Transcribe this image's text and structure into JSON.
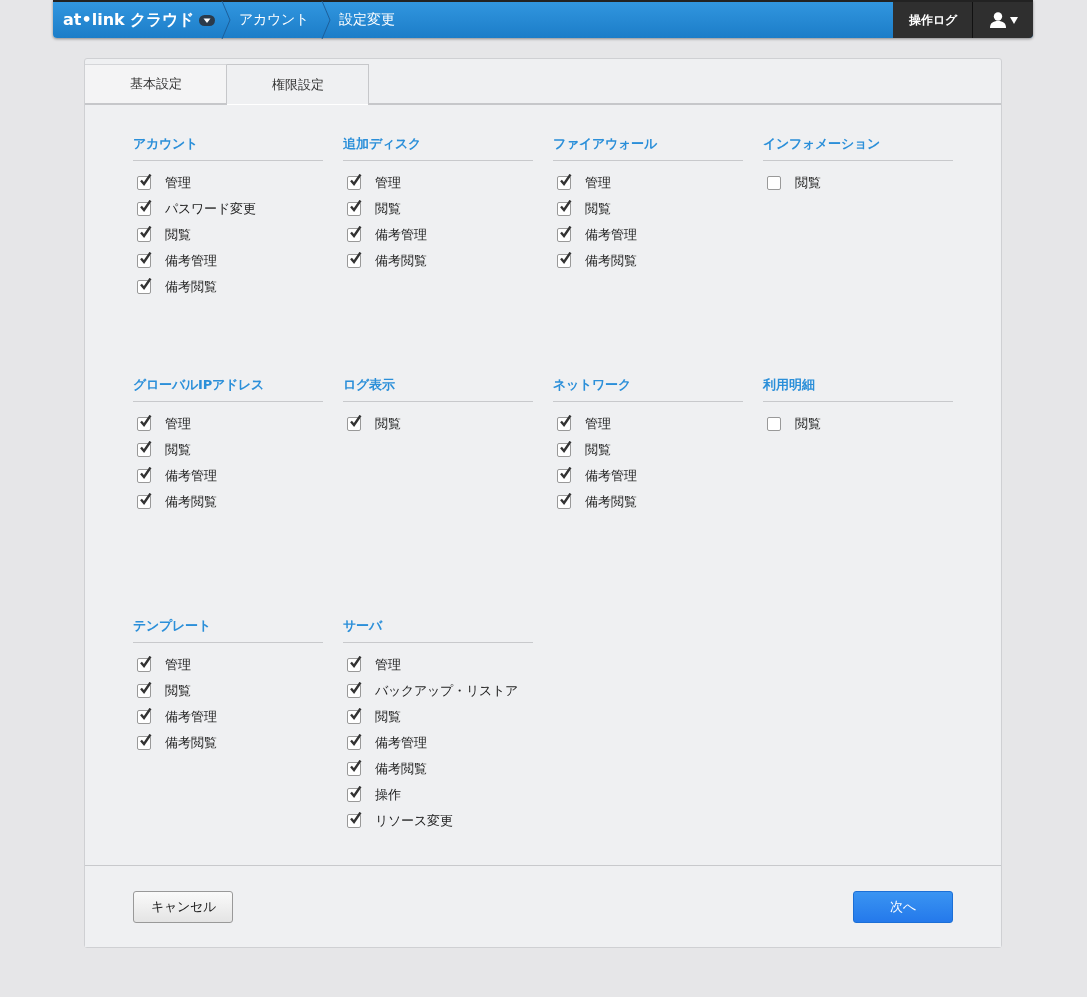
{
  "header": {
    "logo": "at•link クラウド",
    "breadcrumbs": [
      "アカウント",
      "設定変更"
    ],
    "log_button": "操作ログ"
  },
  "tabs": [
    {
      "label": "基本設定",
      "selected": false
    },
    {
      "label": "権限設定",
      "selected": true
    }
  ],
  "groups": [
    {
      "title": "アカウント",
      "items": [
        {
          "label": "管理",
          "checked": true
        },
        {
          "label": "パスワード変更",
          "checked": true
        },
        {
          "label": "閲覧",
          "checked": true
        },
        {
          "label": "備考管理",
          "checked": true
        },
        {
          "label": "備考閲覧",
          "checked": true
        }
      ]
    },
    {
      "title": "追加ディスク",
      "items": [
        {
          "label": "管理",
          "checked": true
        },
        {
          "label": "閲覧",
          "checked": true
        },
        {
          "label": "備考管理",
          "checked": true
        },
        {
          "label": "備考閲覧",
          "checked": true
        }
      ]
    },
    {
      "title": "ファイアウォール",
      "items": [
        {
          "label": "管理",
          "checked": true
        },
        {
          "label": "閲覧",
          "checked": true
        },
        {
          "label": "備考管理",
          "checked": true
        },
        {
          "label": "備考閲覧",
          "checked": true
        }
      ]
    },
    {
      "title": "インフォメーション",
      "items": [
        {
          "label": "閲覧",
          "checked": false
        }
      ]
    },
    {
      "title": "グローバルIPアドレス",
      "items": [
        {
          "label": "管理",
          "checked": true
        },
        {
          "label": "閲覧",
          "checked": true
        },
        {
          "label": "備考管理",
          "checked": true
        },
        {
          "label": "備考閲覧",
          "checked": true
        }
      ]
    },
    {
      "title": "ログ表示",
      "items": [
        {
          "label": "閲覧",
          "checked": true
        }
      ]
    },
    {
      "title": "ネットワーク",
      "items": [
        {
          "label": "管理",
          "checked": true
        },
        {
          "label": "閲覧",
          "checked": true
        },
        {
          "label": "備考管理",
          "checked": true
        },
        {
          "label": "備考閲覧",
          "checked": true
        }
      ]
    },
    {
      "title": "利用明細",
      "items": [
        {
          "label": "閲覧",
          "checked": false
        }
      ]
    },
    {
      "title": "テンプレート",
      "items": [
        {
          "label": "管理",
          "checked": true
        },
        {
          "label": "閲覧",
          "checked": true
        },
        {
          "label": "備考管理",
          "checked": true
        },
        {
          "label": "備考閲覧",
          "checked": true
        }
      ]
    },
    {
      "title": "サーバ",
      "items": [
        {
          "label": "管理",
          "checked": true
        },
        {
          "label": "バックアップ・リストア",
          "checked": true
        },
        {
          "label": "閲覧",
          "checked": true
        },
        {
          "label": "備考管理",
          "checked": true
        },
        {
          "label": "備考閲覧",
          "checked": true
        },
        {
          "label": "操作",
          "checked": true
        },
        {
          "label": "リソース変更",
          "checked": true
        }
      ]
    }
  ],
  "footer": {
    "cancel": "キャンセル",
    "next": "次へ"
  }
}
